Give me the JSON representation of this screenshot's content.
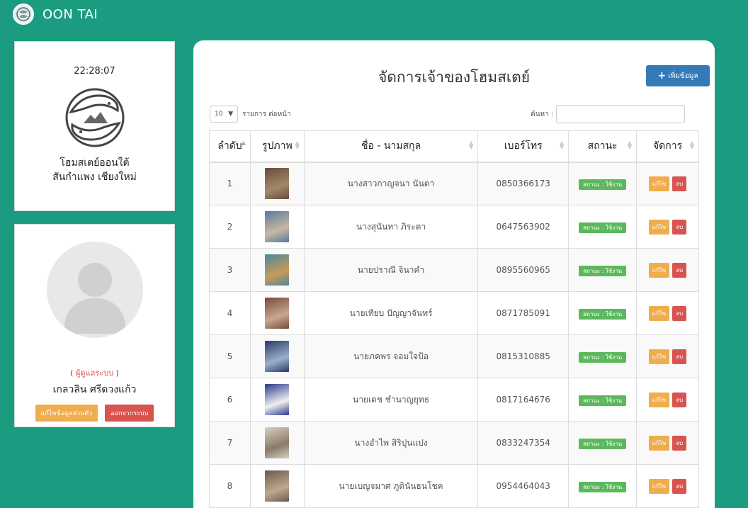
{
  "app": {
    "name": "OON TAI"
  },
  "brand": {
    "clock": "22:28:07",
    "line1": "โฮมสเตย์ออนใต้",
    "line2": "สันกำแพง เชียงใหม่"
  },
  "user": {
    "role_prefix": "(",
    "role": "ผู้ดูแลระบบ",
    "role_suffix": ")",
    "name": "เกลวลิน ศรีดวงแก้ว",
    "edit_profile": "แก้ไขข้อมูลส่วนตัว",
    "logout": "ออกจากระบบ"
  },
  "main": {
    "title": "จัดการเจ้าของโฮมสเตย์",
    "add_label": "เพิ่มข้อมูล",
    "length_value": "10",
    "length_suffix": "รายการ ต่อหน้า",
    "search_label": "ค้นหา :",
    "columns": [
      "ลำดับ",
      "รูปภาพ",
      "ชื่อ - นามสกุล",
      "เบอร์โทร",
      "สถานะ",
      "จัดการ"
    ],
    "status_label": "สถานะ : ใช้งาน",
    "edit_label": "แก้ไข",
    "delete_label": "ลบ",
    "rows": [
      {
        "no": "1",
        "name": "นางสาวกาญจนา นันตา",
        "phone": "0850366173"
      },
      {
        "no": "2",
        "name": "นางสุนันทา ภิระตา",
        "phone": "0647563902"
      },
      {
        "no": "3",
        "name": "นายปราณี จินาคำ",
        "phone": "0895560965"
      },
      {
        "no": "4",
        "name": "นายเทียบ ปัญญาจันทร์",
        "phone": "0871785091"
      },
      {
        "no": "5",
        "name": "นายภคพร จอมใจป้อ",
        "phone": "0815310885"
      },
      {
        "no": "6",
        "name": "นายเดช ชำนาญยุทธ",
        "phone": "0817164676"
      },
      {
        "no": "7",
        "name": "นางอำไพ สิริปุนแปง",
        "phone": "0833247354"
      },
      {
        "no": "8",
        "name": "นายเบญจมาศ ภูดินันธนโชค",
        "phone": "0954464043"
      }
    ]
  },
  "colors": {
    "background": "#1b9c80",
    "primary": "#337ab7",
    "success": "#5cb85c",
    "warning": "#f0ad4e",
    "danger": "#d9534f"
  },
  "icons": {
    "logo": "fish-circle-logo",
    "add": "plus-icon",
    "avatar": "user-placeholder-icon"
  }
}
